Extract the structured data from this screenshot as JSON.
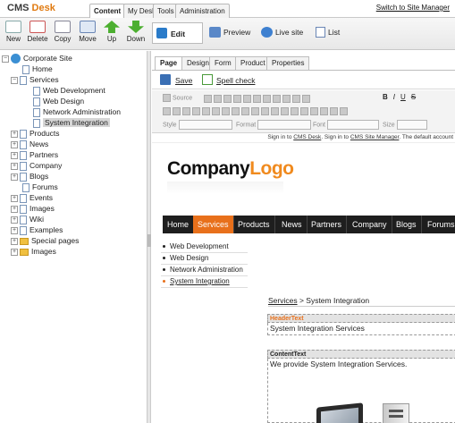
{
  "header": {
    "logo_cms": "CMS",
    "logo_desk": "Desk",
    "tabs": [
      "Content",
      "My Desk",
      "Tools",
      "Administration"
    ],
    "switch_link": "Switch to Site Manager"
  },
  "toolbar": {
    "buttons": [
      "New",
      "Delete",
      "Copy",
      "Move",
      "Up",
      "Down"
    ]
  },
  "tree": {
    "root": "Corporate Site",
    "home": "Home",
    "services": "Services",
    "services_children": [
      "Web Development",
      "Web Design",
      "Network Administration",
      "System Integration"
    ],
    "after": [
      "Products",
      "News",
      "Partners",
      "Company",
      "Blogs",
      "Forums",
      "Events",
      "Images",
      "Wiki",
      "Examples",
      "Special pages",
      "Images"
    ]
  },
  "view_modes": {
    "edit": "Edit",
    "preview": "Preview",
    "live": "Live site",
    "list": "List"
  },
  "subtabs": [
    "Page",
    "Design",
    "Form",
    "Product",
    "Properties"
  ],
  "actions": {
    "save": "Save",
    "spell": "Spell check"
  },
  "editor": {
    "source": "Source",
    "style": "Style",
    "format": "Format",
    "font": "Font",
    "size": "Size"
  },
  "signbar": {
    "p1": "Sign in to ",
    "cms_desk": "CMS Desk",
    "p2": ". Sign in to ",
    "site_manager": "CMS Site Manager",
    "p3": ". The default account"
  },
  "site": {
    "logo_company": "Company",
    "logo_logo": "Logo",
    "menu": [
      "Home",
      "Services",
      "Products",
      "News",
      "Partners",
      "Company",
      "Blogs",
      "Forums"
    ],
    "sidemenu": [
      "Web Development",
      "Web Design",
      "Network Administration",
      "System Integration"
    ],
    "breadcrumb_link": "Services",
    "breadcrumb_rest": " > System Integration",
    "header_label": "HeaderText",
    "header_value": "System Integration Services",
    "content_label": "ContentText",
    "content_value": "We provide System Integration Services."
  },
  "colors": {
    "accent": "#e8701b",
    "menu_bg": "#1e1e1e"
  }
}
